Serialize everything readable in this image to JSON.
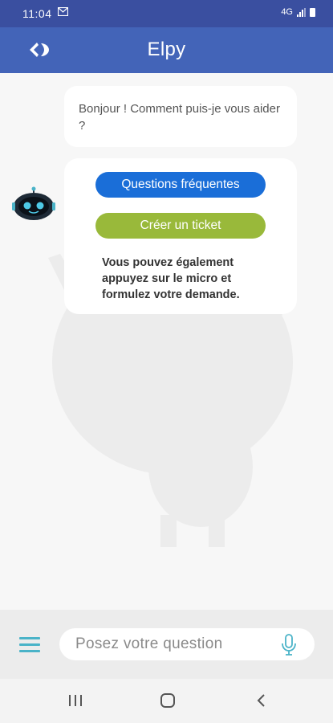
{
  "status_bar": {
    "time": "11:04",
    "notification_icon": "message-icon",
    "signal_label": "4G"
  },
  "header": {
    "title": "Elpy",
    "logo_icon": "carrefour-logo",
    "colors": {
      "status": "#3a4fa0",
      "header": "#4364b8"
    }
  },
  "chat": {
    "greeting": "Bonjour ! Comment puis-je vous aider ?",
    "buttons": {
      "faq_label": "Questions fréquentes",
      "ticket_label": "Créer un ticket"
    },
    "info_text": "Vous pouvez également appuyez sur le micro et formulez votre demande."
  },
  "input_bar": {
    "placeholder": "Posez votre question",
    "value": ""
  },
  "colors": {
    "faq_button": "#1a6ed8",
    "ticket_button": "#99b93a",
    "accent": "#4ab3c8"
  }
}
